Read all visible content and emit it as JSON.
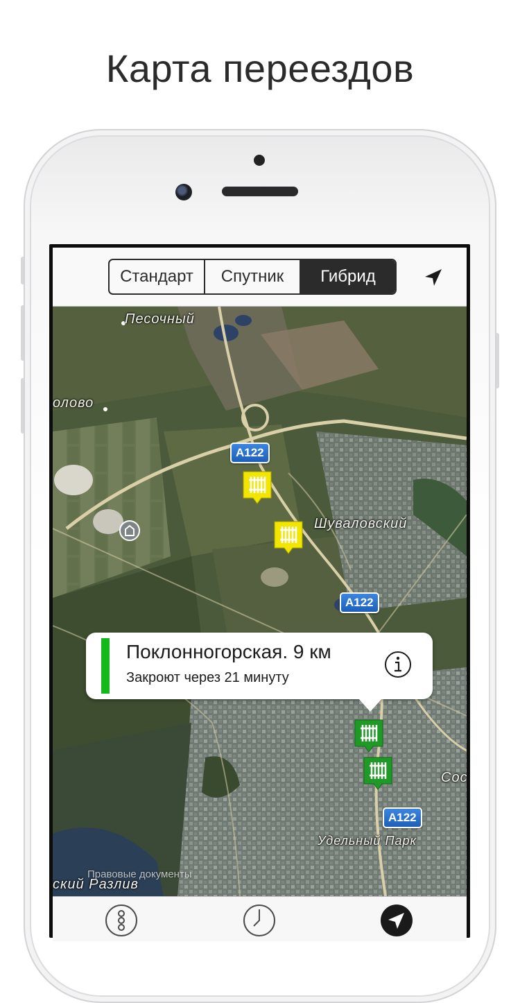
{
  "headline": "Карта переездов",
  "segmented": {
    "items": [
      "Стандарт",
      "Спутник",
      "Гибрид"
    ],
    "selected": "Гибрид"
  },
  "map": {
    "places": {
      "pesochny": "Песочный",
      "olovo": "олово",
      "shuvalovsky": "Шуваловский",
      "udelny_park": "Удельный Парк",
      "sos": "Сос",
      "razliv": "ский Разлив"
    },
    "road_shields": [
      "A122",
      "A122",
      "A122"
    ],
    "legal_link": "Правовые документы",
    "crossing_markers": [
      {
        "status": "warning",
        "color": "#f2e600"
      },
      {
        "status": "warning",
        "color": "#f2e600"
      },
      {
        "status": "open",
        "color": "#1f9a26"
      },
      {
        "status": "open",
        "color": "#1f9a26"
      }
    ]
  },
  "callout": {
    "title": "Поклонногорская. 9 км",
    "subtitle": "Закроют через 21 минуту",
    "status_color": "#14b81a",
    "info_icon": "info-icon"
  },
  "tabbar": {
    "icons": [
      "traffic-light-icon",
      "clock-icon",
      "location-arrow-icon"
    ],
    "active": "location-arrow-icon"
  }
}
